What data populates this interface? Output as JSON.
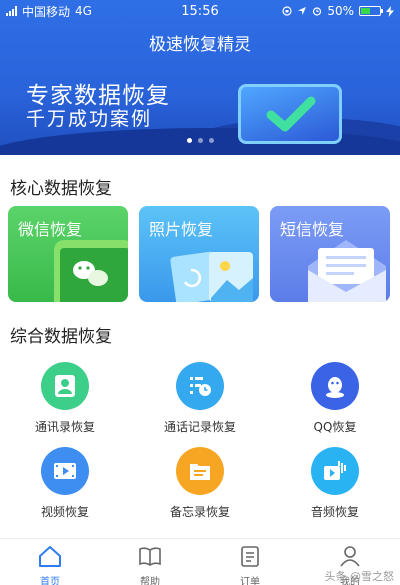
{
  "status_bar": {
    "carrier": "中国移动",
    "network": "4G",
    "time": "15:56",
    "battery": "50%",
    "battery_level": 0.5
  },
  "header": {
    "title": "极速恢复精灵"
  },
  "banner": {
    "line1": "专家数据恢复",
    "line2": "千万成功案例",
    "slide_count": 3,
    "active_slide": 1
  },
  "core": {
    "title": "核心数据恢复",
    "cards": [
      {
        "label": "微信恢复"
      },
      {
        "label": "照片恢复"
      },
      {
        "label": "短信恢复"
      }
    ]
  },
  "general": {
    "title": "综合数据恢复",
    "items": [
      {
        "label": "通讯录恢复",
        "icon": "contacts-icon",
        "color": "#3ccf8a"
      },
      {
        "label": "通话记录恢复",
        "icon": "call-log-icon",
        "color": "#35a9f0"
      },
      {
        "label": "QQ恢复",
        "icon": "qq-icon",
        "color": "#3a63e6"
      },
      {
        "label": "视频恢复",
        "icon": "video-icon",
        "color": "#3d8ef0"
      },
      {
        "label": "备忘录恢复",
        "icon": "memo-icon",
        "color": "#f6a623"
      },
      {
        "label": "音频恢复",
        "icon": "audio-icon",
        "color": "#2ab3f2"
      }
    ]
  },
  "tabbar": {
    "tabs": [
      {
        "label": "首页"
      },
      {
        "label": "帮助"
      },
      {
        "label": "订单"
      },
      {
        "label": "我的"
      }
    ],
    "active_color": "#2f7cf0"
  },
  "watermark": "头条 @雪之怒"
}
